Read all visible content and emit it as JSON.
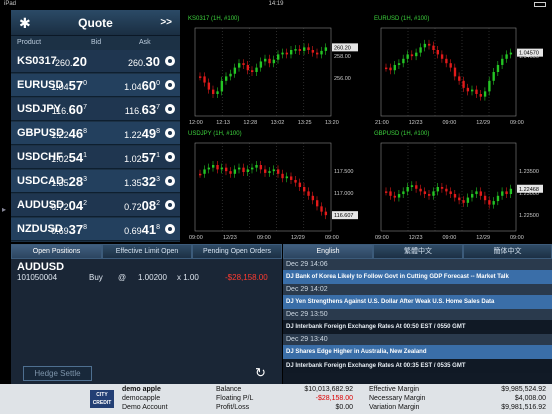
{
  "status": {
    "device": "iPad",
    "time": "14:19"
  },
  "quote": {
    "title": "Quote",
    "more": ">>",
    "columns": {
      "product": "Product",
      "bid": "Bid",
      "ask": "Ask"
    },
    "rows": [
      {
        "symbol": "KS0317",
        "bid_pre": "260.",
        "bid_big": "20",
        "bid_sup": "",
        "ask_pre": "260.",
        "ask_big": "30",
        "ask_sup": ""
      },
      {
        "symbol": "EURUSD",
        "bid_pre": "1.04",
        "bid_big": "57",
        "bid_sup": "0",
        "ask_pre": "1.04",
        "ask_big": "60",
        "ask_sup": "0"
      },
      {
        "symbol": "USDJPY",
        "bid_pre": "116.",
        "bid_big": "60",
        "bid_sup": "7",
        "ask_pre": "116.",
        "ask_big": "63",
        "ask_sup": "7"
      },
      {
        "symbol": "GBPUSD",
        "bid_pre": "1.22",
        "bid_big": "46",
        "bid_sup": "8",
        "ask_pre": "1.22",
        "ask_big": "49",
        "ask_sup": "8"
      },
      {
        "symbol": "USDCHF",
        "bid_pre": "1.02",
        "bid_big": "54",
        "bid_sup": "1",
        "ask_pre": "1.02",
        "ask_big": "57",
        "ask_sup": "1"
      },
      {
        "symbol": "USDCAD",
        "bid_pre": "1.35",
        "bid_big": "28",
        "bid_sup": "3",
        "ask_pre": "1.35",
        "ask_big": "32",
        "ask_sup": "3"
      },
      {
        "symbol": "AUDUSD",
        "bid_pre": "0.72",
        "bid_big": "04",
        "bid_sup": "2",
        "ask_pre": "0.72",
        "ask_big": "08",
        "ask_sup": "2"
      },
      {
        "symbol": "NZDUSD",
        "bid_pre": "0.69",
        "bid_big": "37",
        "bid_sup": "8",
        "ask_pre": "0.69",
        "ask_big": "41",
        "ask_sup": "8"
      }
    ]
  },
  "charts": [
    {
      "title": "KS0317 (1H, #100)",
      "last": "260.20",
      "yticks": [
        "258.00",
        "256.00"
      ],
      "xticks": [
        "12:00",
        "12:13",
        "12:28",
        "13:02",
        "13:25",
        "13:20"
      ],
      "up": "#24c524",
      "down": "#e21a1a"
    },
    {
      "title": "EURUSD (1H, #100)",
      "last": "1.04570",
      "yticks": [
        "1.04000"
      ],
      "xticks": [
        "21:00",
        "12/23",
        "09:00",
        "12/29",
        "09:00"
      ],
      "up": "#24c524",
      "down": "#e21a1a"
    },
    {
      "title": "USDJPY (1H, #100)",
      "last": "116.607",
      "yticks": [
        "117.500",
        "117.000"
      ],
      "xticks": [
        "09:00",
        "12/23",
        "09:00",
        "12/29",
        "09:00"
      ],
      "up": "#24c524",
      "down": "#e21a1a"
    },
    {
      "title": "GBPUSD (1H, #100)",
      "last": "1.22468",
      "yticks": [
        "1.23500",
        "1.23000",
        "1.22500"
      ],
      "xticks": [
        "09:00",
        "12/23",
        "09:00",
        "12/29",
        "09:00"
      ],
      "up": "#24c524",
      "down": "#e21a1a"
    }
  ],
  "orders": {
    "tabs": [
      "Open Positions",
      "Effective Limit Open",
      "Pending Open Orders"
    ],
    "symbol": "AUDUSD",
    "ticket": "101050004",
    "side": "Buy",
    "at": "@",
    "price": "1.00200",
    "qty": "x 1.00",
    "pl": "-$28,158.00",
    "hedge_label": "Hedge Settle",
    "refresh_icon": "↻"
  },
  "news": {
    "tabs": [
      "English",
      "繁體中文",
      "簡体中文"
    ],
    "items": [
      {
        "date": "Dec 29 14:06",
        "headline": "DJ Bank of Korea Likely to Follow Govt in Cutting GDP Forecast -- Market Talk",
        "highlight": true
      },
      {
        "date": "Dec 29 14:02",
        "headline": "DJ Yen Strengthens Against U.S. Dollar After Weak U.S. Home Sales Data",
        "highlight": true
      },
      {
        "date": "Dec 29 13:50",
        "headline": "DJ Interbank Foreign Exchange Rates At 00:50 EST / 0550 GMT",
        "highlight": false
      },
      {
        "date": "Dec 29 13:40",
        "headline": "DJ Shares Edge Higher in Australia, New Zealand",
        "highlight": true
      },
      {
        "date": "",
        "headline": "DJ Interbank Foreign Exchange Rates At 00:35 EST / 0535 GMT",
        "highlight": false
      }
    ]
  },
  "account": {
    "logo": "CITY CREDIT",
    "name": "demo apple",
    "user": "democapple",
    "type": "Demo Account",
    "balance_label": "Balance",
    "balance": "$10,013,682.92",
    "floating_label": "Floating P/L",
    "floating": "-$28,158.00",
    "profit_label": "Profit/Loss",
    "profit": "$0.00",
    "eff_margin_label": "Effective Margin",
    "eff_margin": "$9,985,524.92",
    "nec_margin_label": "Necessary Margin",
    "nec_margin": "$4,008.00",
    "var_margin_label": "Variation Margin",
    "var_margin": "$9,981,516.92"
  }
}
